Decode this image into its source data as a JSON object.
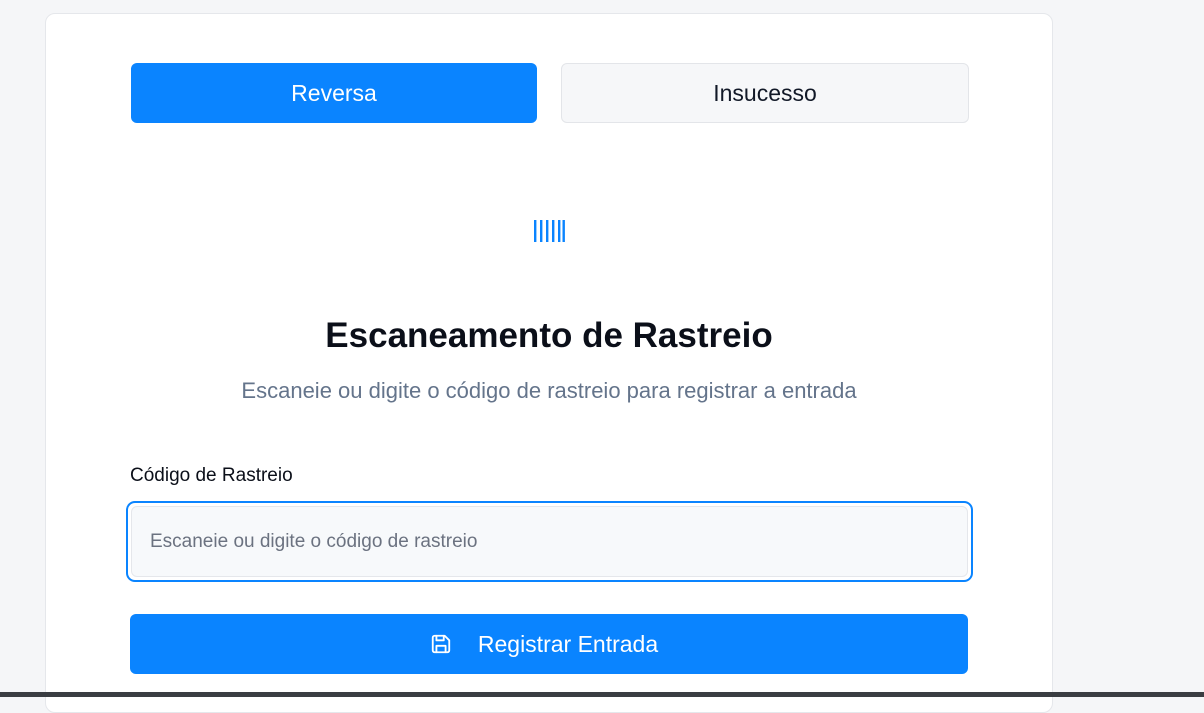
{
  "tabs": [
    {
      "label": "Reversa",
      "active": true
    },
    {
      "label": "Insucesso",
      "active": false
    }
  ],
  "scanner": {
    "icon": "barcode-icon",
    "title": "Escaneamento de Rastreio",
    "subtitle": "Escaneie ou digite o código de rastreio para registrar a entrada"
  },
  "form": {
    "label": "Código de Rastreio",
    "placeholder": "Escaneie ou digite o código de rastreio",
    "value": "",
    "submit_label": "Registrar Entrada",
    "submit_icon": "save-icon"
  },
  "colors": {
    "accent": "#0a84ff",
    "title": "#0b0f19",
    "muted": "#64748b"
  }
}
